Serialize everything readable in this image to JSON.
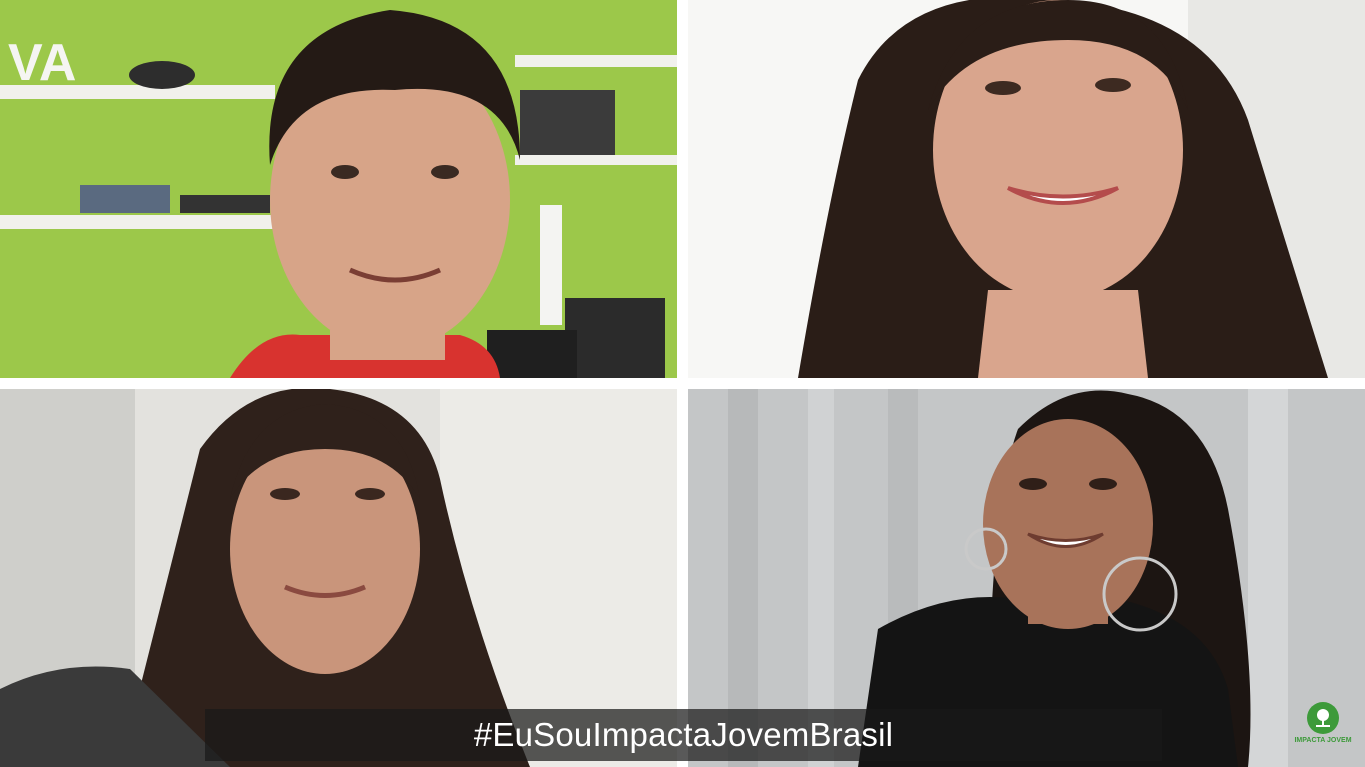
{
  "call": {
    "tiles": [
      {
        "id": "participant-1"
      },
      {
        "id": "participant-2"
      },
      {
        "id": "participant-3"
      },
      {
        "id": "participant-4"
      }
    ]
  },
  "caption": {
    "text": "#EuSouImpactaJovemBrasil"
  },
  "logo": {
    "text": "IMPACTA JOVEM",
    "icon": "tree-icon",
    "color": "#3d9a3a"
  },
  "backgrounds": {
    "wall_green": "#9cc84a",
    "wall_white": "#eeeeec",
    "wall_gray": "#dcdcd8",
    "curtain_gray": "#c9cbcc"
  }
}
